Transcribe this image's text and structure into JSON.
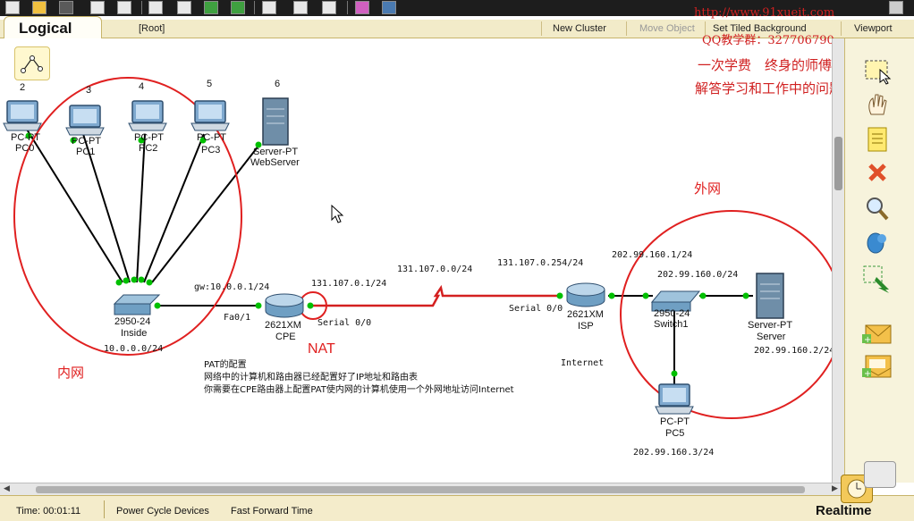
{
  "toolbar": {
    "icons": [
      "new-icon",
      "open-icon",
      "save-icon",
      "print-icon",
      "wizard-icon",
      "note-icon",
      "edit-icon",
      "undo-icon",
      "redo-icon",
      "zoom-in-icon",
      "zoom-reset-icon",
      "zoom-out-icon",
      "palette-icon",
      "custom-device-icon",
      "help-icon"
    ]
  },
  "tabbar": {
    "logical": "Logical",
    "root": "[Root]",
    "new_cluster": "New Cluster",
    "move_object": "Move Object",
    "set_tiled_background": "Set Tiled Background",
    "viewport": "Viewport"
  },
  "watermark": {
    "url": "http://www.91xueit.com",
    "qq": "QQ教学群：327706790",
    "line1": "一次学费　终身的师傅",
    "line2": "解答学习和工作中的问题"
  },
  "numbers": {
    "n2": "2",
    "n3": "3",
    "n4": "4",
    "n5": "5",
    "n6": "6"
  },
  "devices": {
    "pc0": {
      "type": "PC-PT",
      "name": "PC0"
    },
    "pc1": {
      "type": "PC-PT",
      "name": "PC1"
    },
    "pc2": {
      "type": "PC-PT",
      "name": "PC2"
    },
    "pc3": {
      "type": "PC-PT",
      "name": "PC3"
    },
    "webserver": {
      "type": "Server-PT",
      "name": "WebServer"
    },
    "inside_switch": {
      "type": "2950-24",
      "name": "Inside"
    },
    "cpe": {
      "type": "2621XM",
      "name": "CPE"
    },
    "isp": {
      "type": "2621XM",
      "name": "ISP"
    },
    "switch1": {
      "type": "2950-24",
      "name": "Switch1"
    },
    "server": {
      "type": "Server-PT",
      "name": "Server"
    },
    "pc5": {
      "type": "PC-PT",
      "name": "PC5"
    }
  },
  "labels": {
    "inside_net": "10.0.0.0/24",
    "gw": "gw:10.0.0.1/24",
    "fa01": "Fa0/1",
    "cpe_ip": "131.107.0.1/24",
    "serial_cpe": "Serial 0/0",
    "wan_net": "131.107.0.0/24",
    "isp_ip": "131.107.0.254/24",
    "serial_isp": "Serial 0/0",
    "isp_lan_ip": "202.99.160.1/24",
    "outside_net": "202.99.160.0/24",
    "server_ip": "202.99.160.2/24",
    "pc5_ip": "202.99.160.3/24",
    "internet": "Internet"
  },
  "annotations": {
    "inner": "内网",
    "outer": "外网",
    "nat": "NAT"
  },
  "note": {
    "title": "PAT的配置",
    "line1": "网络中的计算机和路由器已经配置好了IP地址和路由表",
    "line2": "你需要在CPE路由器上配置PAT使内网的计算机使用一个外网地址访问Internet"
  },
  "palette": {
    "icons": [
      "select-icon",
      "move-icon",
      "note-icon",
      "delete-icon",
      "inspect-icon",
      "draw-shape-icon",
      "resize-icon",
      "add-simple-pdu-icon",
      "add-complex-pdu-icon"
    ]
  },
  "status": {
    "time": "Time: 00:01:11",
    "power_cycle": "Power Cycle Devices",
    "fast_forward": "Fast Forward Time",
    "realtime": "Realtime"
  },
  "colors": {
    "link_ok": "#00c000",
    "serial_link": "#d42020",
    "annotation": "#e02020"
  }
}
